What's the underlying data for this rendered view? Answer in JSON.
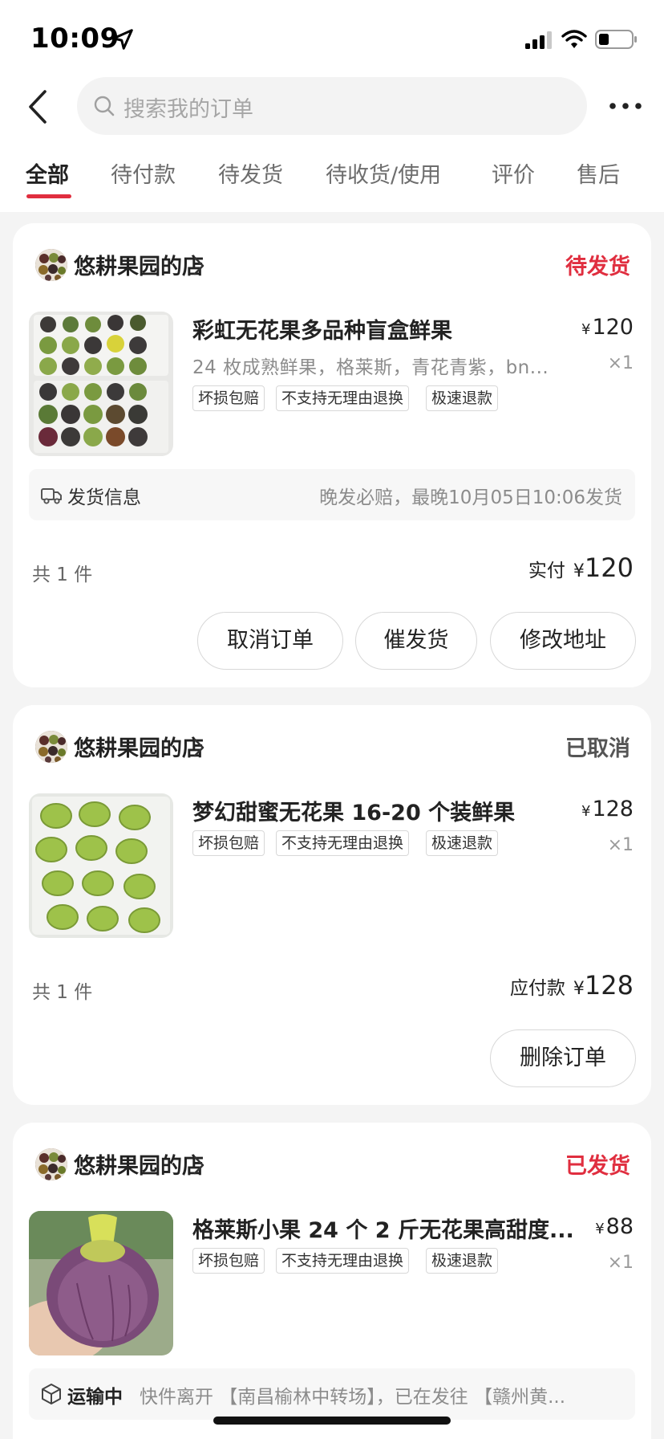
{
  "status_bar": {
    "time": "10:09"
  },
  "search": {
    "placeholder": "搜索我的订单"
  },
  "tabs": [
    "全部",
    "待付款",
    "待发货",
    "待收货/使用",
    "评价",
    "售后"
  ],
  "colors": {
    "accent": "#e02e3f",
    "muted_status": "#555555"
  },
  "orders": [
    {
      "shop": "悠耕果园的店",
      "status": "待发货",
      "title": "彩虹无花果多品种盲盒鲜果",
      "spec": "24 枚成熟鲜果，格莱斯，青花青紫，bn...",
      "price_symbol": "¥",
      "price": "120",
      "qty": "×1",
      "tags": [
        "坏损包赔",
        "不支持无理由退换",
        "极速退款"
      ],
      "ship_label": "发货信息",
      "ship_note": "晚发必赔，最晚10月05日10:06发货",
      "count": "共 1 件",
      "total_label": "实付",
      "total_symbol": "¥",
      "total": "120",
      "buttons": [
        "取消订单",
        "催发货",
        "修改地址"
      ]
    },
    {
      "shop": "悠耕果园的店",
      "status": "已取消",
      "title": "梦幻甜蜜无花果 16-20 个装鲜果",
      "price_symbol": "¥",
      "price": "128",
      "qty": "×1",
      "tags": [
        "坏损包赔",
        "不支持无理由退换",
        "极速退款"
      ],
      "count": "共 1 件",
      "total_label": "应付款",
      "total_symbol": "¥",
      "total": "128",
      "buttons": [
        "删除订单"
      ]
    },
    {
      "shop": "悠耕果园的店",
      "status": "已发货",
      "title": "格莱斯小果 24 个 2 斤无花果高甜度...",
      "price_symbol": "¥",
      "price": "88",
      "qty": "×1",
      "tags": [
        "坏损包赔",
        "不支持无理由退换",
        "极速退款"
      ],
      "transit_label": "运输中",
      "transit_note": "快件离开 【南昌榆林中转场】，已在发往 【赣州黄..."
    }
  ]
}
